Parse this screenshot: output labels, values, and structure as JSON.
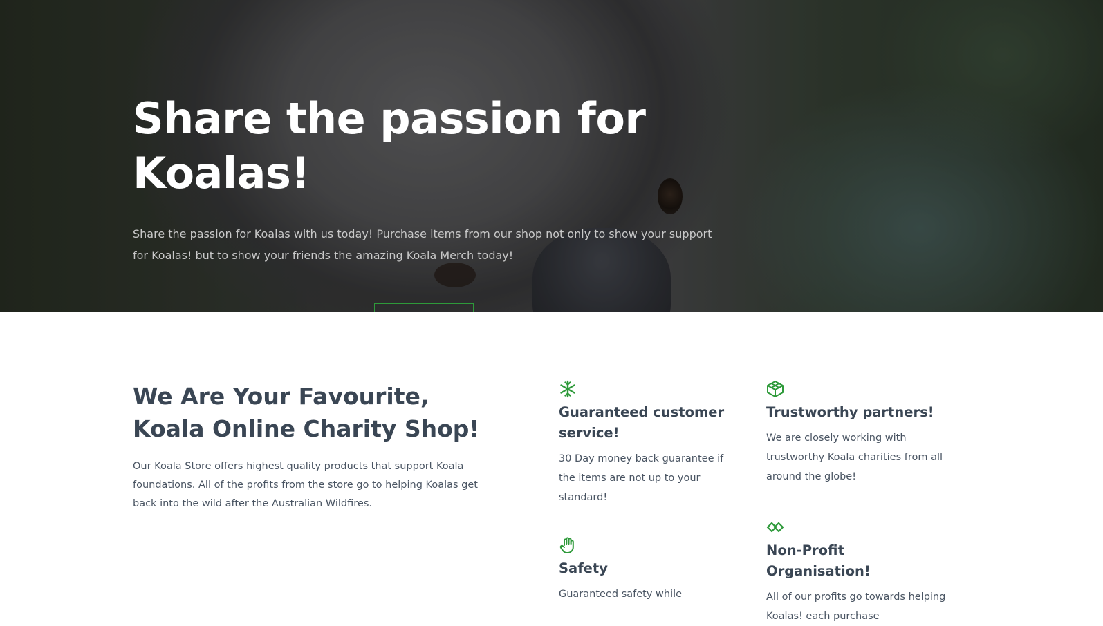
{
  "hero": {
    "title": "Share the passion for Koalas!",
    "text": "Share the passion for Koalas with us today! Purchase items from our shop not only to show your support for Koalas! but to show your friends the amazing Koala Merch today!"
  },
  "about": {
    "title": "We Are Your Favourite, Koala Online Charity Shop!",
    "text": "Our Koala Store offers highest quality products that support Koala foundations. All of the profits from the store go to helping Koalas get back into the wild after the Australian Wildfires."
  },
  "features": [
    {
      "icon": "snowflake-icon",
      "title": "Guaranteed customer service!",
      "text": "30 Day money back guarantee if the items are not up to your standard!"
    },
    {
      "icon": "cube-icon",
      "title": "Trustworthy partners!",
      "text": "We are closely working with trustworthy Koala charities from all around the globe!"
    },
    {
      "icon": "hand-icon",
      "title": "Safety",
      "text": "Guaranteed safety while"
    },
    {
      "icon": "codepen-icon",
      "title": "Non-Profit Organisation!",
      "text": "All of our profits go towards helping Koalas! each purchase"
    }
  ],
  "colors": {
    "accent": "#2e9a3a",
    "heading": "#3a4654",
    "body_text": "#4a5563"
  }
}
